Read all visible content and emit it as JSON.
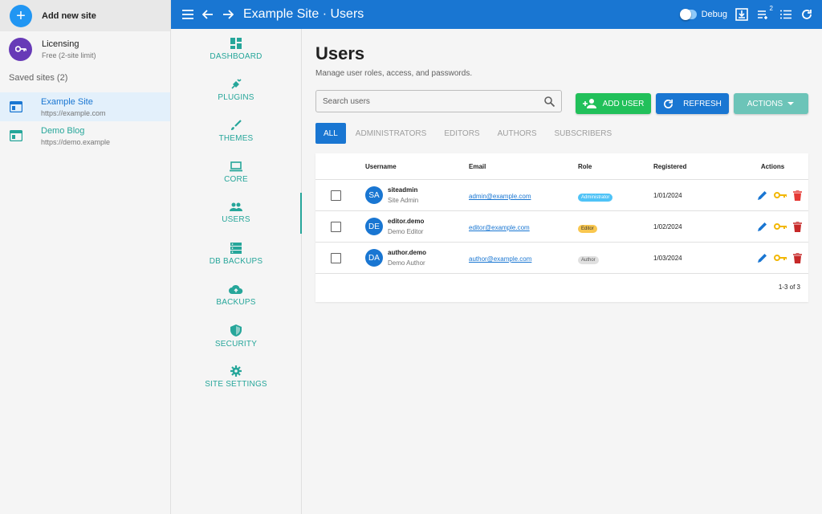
{
  "sites_panel": {
    "add_site_label": "Add new site",
    "licensing_title": "Licensing",
    "licensing_sub": "Free (2-site limit)",
    "saved_label": "Saved sites (2)",
    "sites": [
      {
        "name": "Example Site",
        "url": "https://example.com"
      },
      {
        "name": "Demo Blog",
        "url": "https://demo.example"
      }
    ]
  },
  "topbar": {
    "title": "Example Site · Users",
    "debug_label": "Debug",
    "queue_badge": "2"
  },
  "nav": {
    "items": [
      {
        "label": "DASHBOARD",
        "icon": "dashboard-icon"
      },
      {
        "label": "PLUGINS",
        "icon": "plugin-icon"
      },
      {
        "label": "THEMES",
        "icon": "brush-icon"
      },
      {
        "label": "CORE",
        "icon": "laptop-icon"
      },
      {
        "label": "USERS",
        "icon": "users-icon"
      },
      {
        "label": "DB BACKUPS",
        "icon": "database-icon"
      },
      {
        "label": "BACKUPS",
        "icon": "cloud-upload-icon"
      },
      {
        "label": "SECURITY",
        "icon": "shield-icon"
      },
      {
        "label": "SITE SETTINGS",
        "icon": "gear-icon"
      }
    ]
  },
  "main": {
    "title": "Users",
    "subtitle": "Manage user roles, access, and passwords.",
    "search_placeholder": "Search users",
    "add_user_label": "ADD USER",
    "refresh_label": "REFRESH",
    "actions_label": "ACTIONS",
    "tabs": [
      "ALL",
      "ADMINISTRATORS",
      "EDITORS",
      "AUTHORS",
      "SUBSCRIBERS"
    ],
    "columns": {
      "username": "Username",
      "email": "Email",
      "role": "Role",
      "registered": "Registered",
      "actions": "Actions"
    },
    "rows": [
      {
        "initials": "SA",
        "username": "siteadmin",
        "display": "Site Admin",
        "email": "admin@example.com",
        "role": "Administrator",
        "registered": "1/01/2024"
      },
      {
        "initials": "DE",
        "username": "editor.demo",
        "display": "Demo Editor",
        "email": "editor@example.com",
        "role": "Editor",
        "registered": "1/02/2024"
      },
      {
        "initials": "DA",
        "username": "author.demo",
        "display": "Demo Author",
        "email": "author@example.com",
        "role": "Author",
        "registered": "1/03/2024"
      }
    ],
    "pagination": "1-3 of 3"
  },
  "colors": {
    "primary": "#1976d2",
    "accent_teal": "#26a69a",
    "add_green": "#21c05a",
    "delete_red": "#e53935",
    "key_yellow": "#f2b705"
  }
}
